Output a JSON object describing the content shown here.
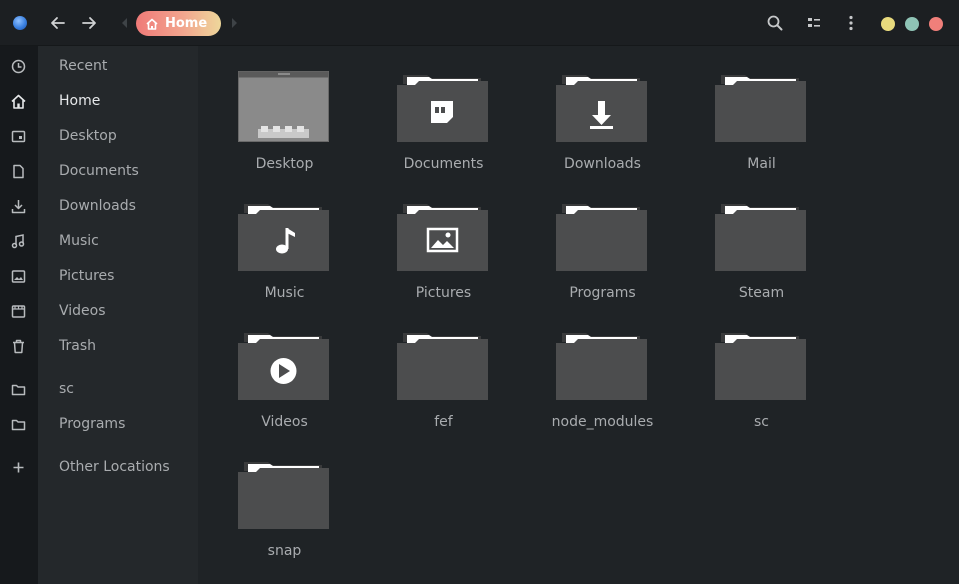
{
  "header": {
    "back_icon": "arrow-left-icon",
    "forward_icon": "arrow-right-icon",
    "breadcrumb_label": "Home",
    "search_icon": "search-icon",
    "view_icon": "list-view-icon",
    "menu_icon": "kebab-menu-icon",
    "window_controls": [
      {
        "name": "minimize",
        "color": "#e8da7d"
      },
      {
        "name": "maximize",
        "color": "#8fc4b6"
      },
      {
        "name": "close",
        "color": "#f07f7a"
      }
    ]
  },
  "sidebar": {
    "items": [
      {
        "label": "Recent",
        "icon": "clock-icon"
      },
      {
        "label": "Home",
        "icon": "home-icon",
        "active": true
      },
      {
        "label": "Desktop",
        "icon": "desktop-icon"
      },
      {
        "label": "Documents",
        "icon": "document-icon"
      },
      {
        "label": "Downloads",
        "icon": "download-icon"
      },
      {
        "label": "Music",
        "icon": "music-icon"
      },
      {
        "label": "Pictures",
        "icon": "picture-icon"
      },
      {
        "label": "Videos",
        "icon": "video-icon"
      },
      {
        "label": "Trash",
        "icon": "trash-icon"
      },
      {
        "label": "sc",
        "icon": "folder-icon"
      },
      {
        "label": "Programs",
        "icon": "folder-icon"
      },
      {
        "label": "Other Locations",
        "icon": "plus-icon"
      }
    ]
  },
  "files": [
    {
      "name": "Desktop",
      "kind": "desktop"
    },
    {
      "name": "Documents",
      "kind": "documents"
    },
    {
      "name": "Downloads",
      "kind": "downloads"
    },
    {
      "name": "Mail",
      "kind": "plain"
    },
    {
      "name": "Music",
      "kind": "music"
    },
    {
      "name": "Pictures",
      "kind": "pictures"
    },
    {
      "name": "Programs",
      "kind": "plain"
    },
    {
      "name": "Steam",
      "kind": "plain"
    },
    {
      "name": "Videos",
      "kind": "videos"
    },
    {
      "name": "fef",
      "kind": "plain"
    },
    {
      "name": "node_modules",
      "kind": "plain"
    },
    {
      "name": "sc",
      "kind": "plain"
    },
    {
      "name": "snap",
      "kind": "plain"
    }
  ],
  "colors": {
    "accent_gradient_start": "#ef7a78",
    "accent_gradient_end": "#eed79b",
    "folder": "#4b4c4d",
    "sidebar_bg": "#24282b",
    "main_bg": "#1f2326"
  }
}
